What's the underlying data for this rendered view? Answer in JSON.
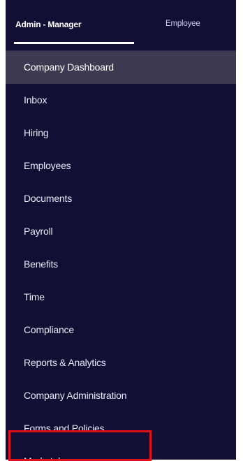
{
  "tabs": {
    "admin_label": "Admin - Manager",
    "employee_label": "Employee",
    "active": "Admin - Manager"
  },
  "nav": {
    "items": [
      {
        "label": "Company Dashboard"
      },
      {
        "label": "Inbox"
      },
      {
        "label": "Hiring"
      },
      {
        "label": "Employees"
      },
      {
        "label": "Documents"
      },
      {
        "label": "Payroll"
      },
      {
        "label": "Benefits"
      },
      {
        "label": "Time"
      },
      {
        "label": "Compliance"
      },
      {
        "label": "Reports & Analytics"
      },
      {
        "label": "Company Administration"
      },
      {
        "label": "Forms and Policies"
      },
      {
        "label": "Marketplace"
      }
    ],
    "active_label": "Company Dashboard",
    "highlighted_label": "Marketplace"
  },
  "colors": {
    "sidebar_bg": "#130e34",
    "active_bg": "#3d3a52",
    "highlight_border": "#e0101a"
  }
}
